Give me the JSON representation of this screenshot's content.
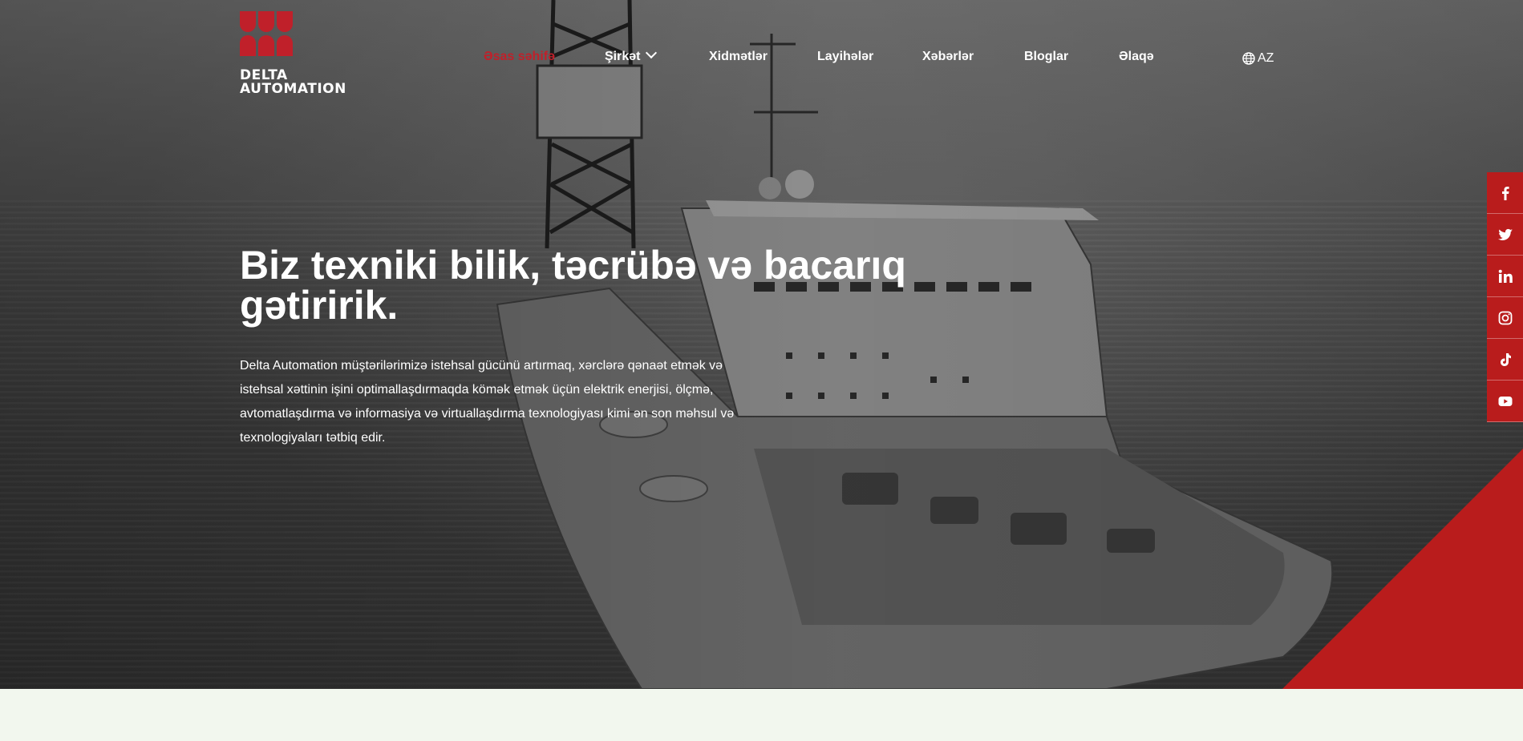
{
  "brand": {
    "name_line1": "DELTA",
    "name_line2": "AUTOMATION",
    "primary_color": "#c0202a"
  },
  "nav": {
    "items": [
      {
        "label": "Əsas səhifə",
        "active": true
      },
      {
        "label": "Şirkət",
        "has_dropdown": true
      },
      {
        "label": "Xidmətlər"
      },
      {
        "label": "Layihələr"
      },
      {
        "label": "Xəbərlər"
      },
      {
        "label": "Bloglar"
      },
      {
        "label": "Əlaqə"
      }
    ],
    "language": {
      "label": "AZ",
      "icon": "globe-icon"
    }
  },
  "hero": {
    "title": "Biz texniki bilik, təcrübə və bacarıq gətiririk.",
    "description": "Delta Automation müştərilərimizə istehsal gücünü artırmaq, xərclərə qənaət etmək və istehsal xəttinin işini optimallaşdırmaqda kömək etmək üçün elektrik enerjisi, ölçmə, avtomatlaşdırma və informasiya və virtuallaşdırma texnologiyası kimi ən son məhsul və texnologiyaları tətbiq edir."
  },
  "social": [
    {
      "icon": "facebook-icon"
    },
    {
      "icon": "twitter-icon"
    },
    {
      "icon": "linkedin-icon"
    },
    {
      "icon": "instagram-icon"
    },
    {
      "icon": "tiktok-icon"
    },
    {
      "icon": "youtube-icon"
    }
  ]
}
